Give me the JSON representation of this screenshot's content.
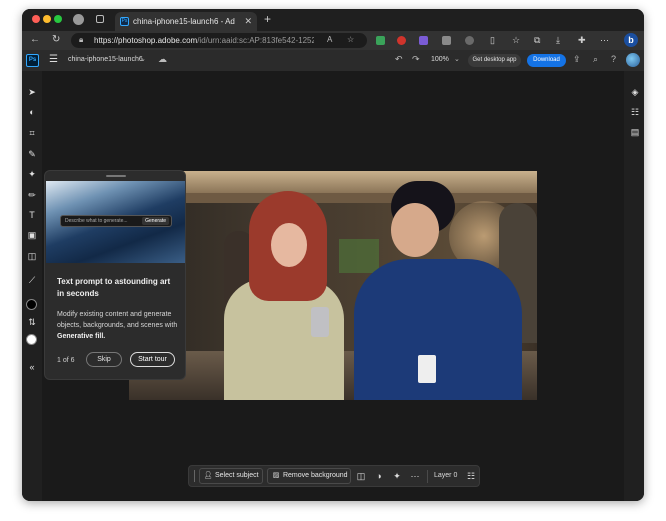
{
  "browser": {
    "tab_title": "china-iphone15-launch6 - Ado",
    "url_host": "https://photoshop.adobe.com",
    "url_path": "/id/urn:aaid:sc:AP:813fe542-1252-..."
  },
  "app": {
    "logo": "Ps",
    "document_name": "china-iphone15-launch6",
    "zoom": "100%",
    "get_app_label": "Get desktop app",
    "download_label": "Download"
  },
  "tour": {
    "prompt_placeholder": "Describe what to generate...",
    "generate_label": "Generate",
    "title": "Text prompt to astounding art in seconds",
    "body": "Modify existing content and generate objects, backgrounds, and scenes with",
    "body_bold": "Generative fill.",
    "counter": "1 of 6",
    "skip_label": "Skip",
    "start_label": "Start tour"
  },
  "taskbar": {
    "select_subject": "Select subject",
    "remove_background": "Remove background",
    "layer": "Layer 0"
  },
  "colors": {
    "accent": "#1473e6",
    "ps_blue": "#31a8ff",
    "window_bg": "#202020",
    "canvas_bg": "#1a1a1a"
  }
}
